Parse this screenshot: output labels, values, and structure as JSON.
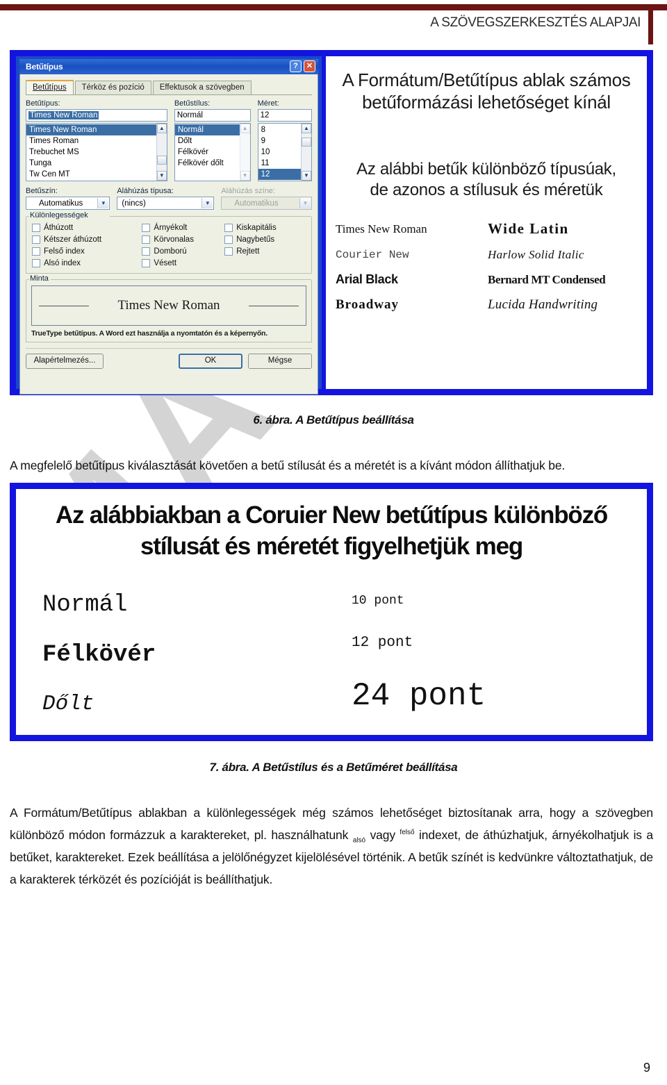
{
  "header": {
    "title": "A SZÖVEGSZERKESZTÉS ALAPJAI",
    "rule_color": "#6b1414"
  },
  "figure6": {
    "frame_color": "#1414e0",
    "dialog": {
      "title": "Betűtípus",
      "titlebar_buttons": {
        "help": "?",
        "close": "✕"
      },
      "tabs": [
        {
          "label": "Betűtípus",
          "active": true
        },
        {
          "label": "Térköz és pozíció",
          "active": false
        },
        {
          "label": "Effektusok a szövegben",
          "active": false
        }
      ],
      "font_label": "Betűtípus:",
      "font_value": "Times New Roman",
      "font_list": [
        "Times New Roman",
        "Times Roman",
        "Trebuchet MS",
        "Tunga",
        "Tw Cen MT"
      ],
      "font_selected_index": 0,
      "style_label": "Betűstílus:",
      "style_value": "Normál",
      "style_list": [
        "Normál",
        "Dőlt",
        "Félkövér",
        "Félkövér dőlt"
      ],
      "style_selected_index": 0,
      "size_label": "Méret:",
      "size_value": "12",
      "size_list": [
        "8",
        "9",
        "10",
        "11",
        "12"
      ],
      "size_selected_index": 4,
      "color_label": "Betűszín:",
      "color_value": "Automatikus",
      "underline_label": "Aláhúzás típusa:",
      "underline_value": "(nincs)",
      "underline_color_label": "Aláhúzás színe:",
      "underline_color_value": "Automatikus",
      "effects_group": "Különlegességek",
      "effects": [
        [
          "Áthúzott",
          "Kétszer áthúzott",
          "Felső index",
          "Alsó index"
        ],
        [
          "Árnyékolt",
          "Körvonalas",
          "Domború",
          "Vésett"
        ],
        [
          "Kiskapitális",
          "Nagybetűs",
          "Rejtett"
        ]
      ],
      "preview_group": "Minta",
      "preview_text": "Times New Roman",
      "preview_note": "TrueType betűtípus. A Word ezt használja a nyomtatón és a képernyőn.",
      "buttons": {
        "defaults": "Alapértelmezés...",
        "ok": "OK",
        "cancel": "Mégse"
      }
    },
    "annotation": {
      "heading_line1": "A Formátum/Betűtípus ablak számos",
      "heading_line2": "betűformázási lehetőséget kínál",
      "sub_line1": "Az alábbi betűk különböző típusúak,",
      "sub_line2": "de azonos a stílusuk és méretük",
      "samples": [
        "Times New Roman",
        "Wide Latin",
        "Courier New",
        "Harlow Solid Italic",
        "Arial Black",
        "Bernard MT Condensed",
        "Broadway",
        "Lucida Handwriting"
      ]
    }
  },
  "caption6": "6. ábra. A Betűtípus beállítása",
  "paragraph1": "A megfelelő betűtípus kiválasztását követően a betű stílusát és a méretét is a kívánt módon állíthatjuk be.",
  "figure7": {
    "frame_color": "#1414e0",
    "heading_line1": "Az alábbiakban a Coruier New betűtípus különböző",
    "heading_line2": "stílusát és méretét figyelhetjük meg",
    "styles": [
      "Normál",
      "Félkövér",
      "Dőlt"
    ],
    "sizes": [
      "10 pont",
      "12 pont",
      "24 pont"
    ]
  },
  "caption7": "7. ábra. A Betűstílus és a Betűméret beállítása",
  "paragraph2": {
    "part1": "A Formátum/Betűtípus ablakban a különlegességek még számos lehetőséget biztosítanak arra, hogy a szövegben különböző módon formázzuk a karaktereket, pl. használhatunk ",
    "sub": "alsó",
    "part2": " vagy ",
    "sup": "felső",
    "part3": " indexet, de áthúzhatjuk, árnyékolhatjuk is a betűket, karaktereket. Ezek beállítása a jelölőnégyzet kijelölésével történik. A betűk színét is kedvünkre változtathatjuk, de a karakterek térközét és pozícióját is beállíthatjuk."
  },
  "watermark_text": "MA",
  "page_number": "9"
}
